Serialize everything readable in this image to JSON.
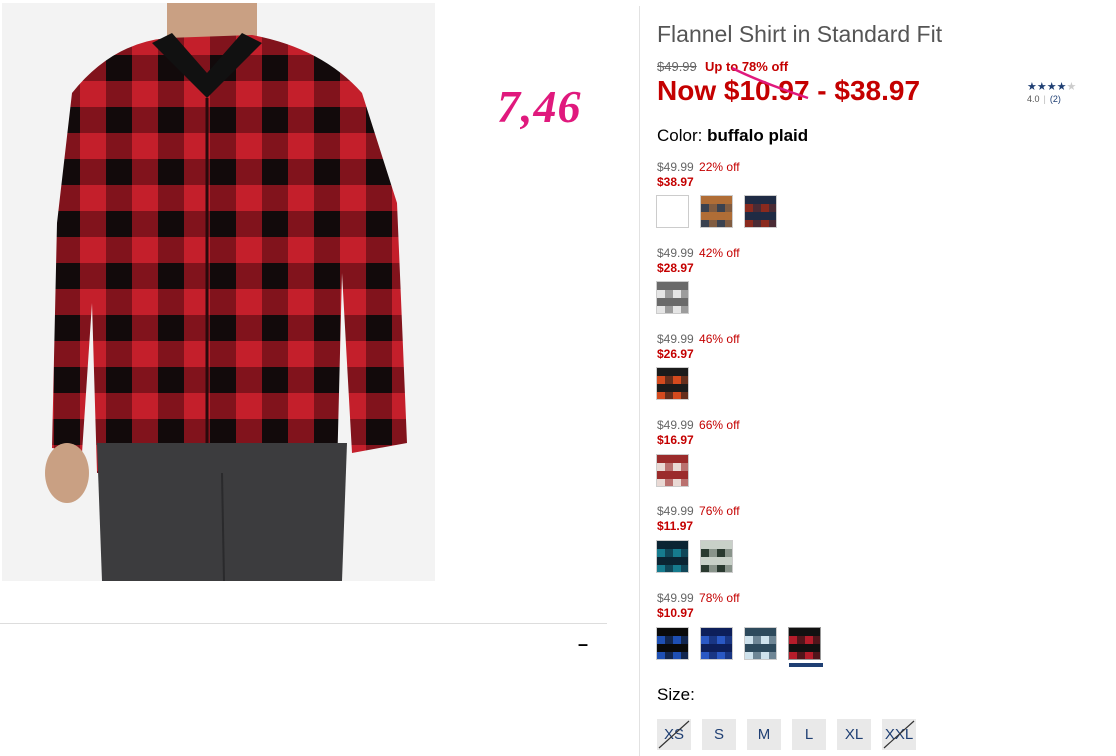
{
  "annotation": "7,46",
  "product": {
    "title": "Flannel Shirt in Standard Fit",
    "original_price": "$49.99",
    "up_to": "Up to 78% off",
    "now_range": "Now $10.97 - $38.97",
    "rating": {
      "value": "4.0",
      "count": "(2)",
      "stars": 4
    },
    "color_label": "Color:",
    "color_value": "buffalo plaid"
  },
  "tiers": [
    {
      "orig": "$49.99",
      "pct": "22% off",
      "price": "$38.97",
      "swatches": [
        {
          "name": "swatch-olive-plaid",
          "c1": "#2f3a2a",
          "c2": "#111"
        },
        {
          "name": "swatch-grey-plaid",
          "c1": "#3a4250",
          "c2": "#b06d36"
        },
        {
          "name": "swatch-red-navy-plaid",
          "c1": "#8a2a1e",
          "c2": "#1f2b44"
        }
      ]
    },
    {
      "orig": "$49.99",
      "pct": "42% off",
      "price": "$28.97",
      "swatches": [
        {
          "name": "swatch-white-plaid",
          "c1": "#e5e5e5",
          "c2": "#6a6a6a"
        }
      ]
    },
    {
      "orig": "$49.99",
      "pct": "46% off",
      "price": "$26.97",
      "swatches": [
        {
          "name": "swatch-orange-plaid",
          "c1": "#d44a1e",
          "c2": "#1b1b1b"
        }
      ]
    },
    {
      "orig": "$49.99",
      "pct": "66% off",
      "price": "$16.97",
      "swatches": [
        {
          "name": "swatch-cream-red-plaid",
          "c1": "#e9d9d4",
          "c2": "#9b2b2b"
        }
      ]
    },
    {
      "orig": "$49.99",
      "pct": "76% off",
      "price": "$11.97",
      "swatches": [
        {
          "name": "swatch-teal-plaid",
          "c1": "#167b8e",
          "c2": "#0b2433"
        },
        {
          "name": "swatch-green-plaid",
          "c1": "#2a3a30",
          "c2": "#c8d0c8"
        }
      ]
    },
    {
      "orig": "$49.99",
      "pct": "78% off",
      "price": "$10.97",
      "swatches": [
        {
          "name": "swatch-blue-black-plaid",
          "c1": "#1e4fb3",
          "c2": "#0a0a0a"
        },
        {
          "name": "swatch-royal-blue-plaid",
          "c1": "#2a58c4",
          "c2": "#0d1f5a"
        },
        {
          "name": "swatch-light-blue-plaid",
          "c1": "#cfe2ec",
          "c2": "#2e4a5c"
        },
        {
          "name": "swatch-buffalo-plaid",
          "c1": "#b51c2a",
          "c2": "#111111",
          "selected": true
        }
      ]
    }
  ],
  "size_label": "Size:",
  "sizes": [
    {
      "label": "XS",
      "available": false
    },
    {
      "label": "S",
      "available": true
    },
    {
      "label": "M",
      "available": true
    },
    {
      "label": "L",
      "available": true
    },
    {
      "label": "XL",
      "available": true
    },
    {
      "label": "XXL",
      "available": false
    }
  ],
  "collapse_symbol": "–",
  "colors": {
    "sale_red": "#c40000",
    "link_navy": "#1f3f73",
    "annotation_pink": "#e0197d"
  }
}
